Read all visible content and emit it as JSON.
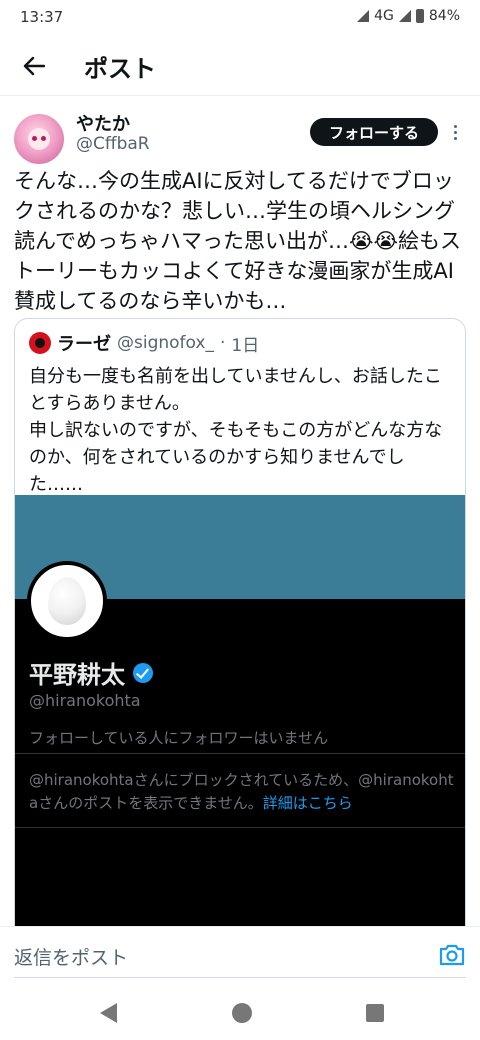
{
  "status_bar": {
    "time": "13:37",
    "network": "4G",
    "battery": "84%"
  },
  "header": {
    "title": "ポスト"
  },
  "post": {
    "author": {
      "display_name": "やたか",
      "handle": "@CffbaR"
    },
    "follow_label": "フォローする",
    "text": "そんな…今の生成AIに反対してるだけでブロックされるのかな？悲しい…学生の頃ヘルシング読んでめっちゃハマった思い出が…😭😭絵もストーリーもカッコよくて好きな漫画家が生成AI賛成してるのなら辛いかも…"
  },
  "quote": {
    "author": {
      "display_name": "ラーゼ",
      "handle": "@signofox_",
      "time": "1日"
    },
    "text": "自分も一度も名前を出していませんし、お話したことすらありません。\n申し訳ないのですが、そもそもこの方がどんな方なのか、何をされているのかすら知りませんでした……",
    "image": {
      "profile_name": "平野耕太",
      "profile_handle": "@hiranokohta",
      "no_followers_text": "フォローしている人にフォロワーはいません",
      "blocked_text": "@hiranokohtaさんにブロックされているため、@hiranokohtaさんのポストを表示できません。",
      "details_link": "詳細はこちら"
    }
  },
  "reply": {
    "placeholder": "返信をポスト"
  },
  "colors": {
    "accent": "#1d9bf0",
    "banner": "#3b7d96",
    "text": "#0f1419",
    "muted": "#536471"
  }
}
